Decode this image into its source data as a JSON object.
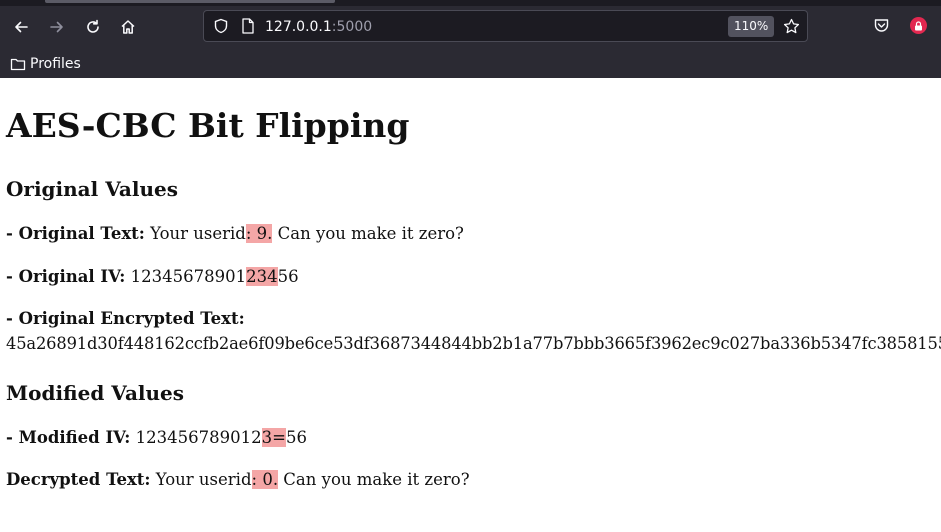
{
  "browser": {
    "url_host": "127.0.0.1",
    "url_port": ":5000",
    "zoom": "110%",
    "bookmarks": [
      {
        "label": "Profiles",
        "icon": "folder-icon"
      }
    ]
  },
  "page": {
    "title": "AES-CBC Bit Flipping",
    "original": {
      "heading": "Original Values",
      "text_label": "- Original Text:",
      "text_before": "Your userid",
      "text_highlight": ": 9.",
      "text_after": " Can you make it zero?",
      "iv_label": "- Original IV:",
      "iv_before": "12345678901",
      "iv_highlight": "234",
      "iv_after": "56",
      "enc_label": "- Original Encrypted Text:",
      "enc_value": "45a26891d30f448162ccfb2ae6f09be6ce53df3687344844bb2b1a77b7bbb3665f3962ec9c027ba336b5347fc3858155"
    },
    "modified": {
      "heading": "Modified Values",
      "iv_label": "- Modified IV:",
      "iv_before": "123456789012",
      "iv_highlight": "3=",
      "iv_after": "56",
      "dec_label": "Decrypted Text:",
      "dec_before": "Your userid",
      "dec_highlight": ": 0.",
      "dec_after": " Can you make it zero?"
    }
  },
  "colors": {
    "chrome_bg": "#2b2a33",
    "urlbar_bg": "#1c1b22",
    "highlight": "#f4a6a6"
  }
}
